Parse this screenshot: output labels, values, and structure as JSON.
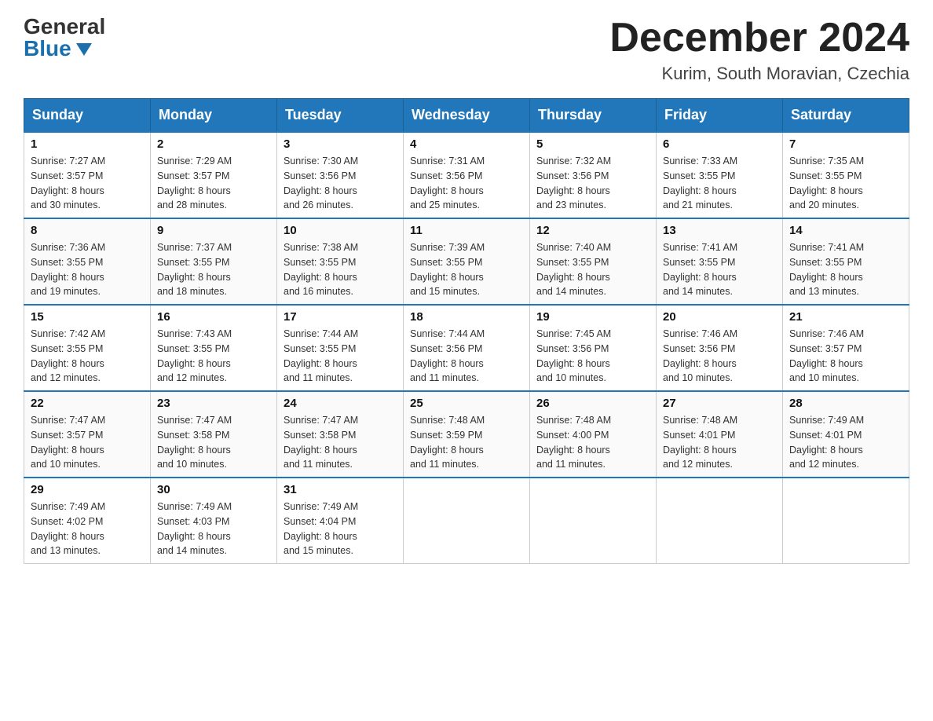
{
  "header": {
    "logo_general": "General",
    "logo_blue": "Blue",
    "month_title": "December 2024",
    "location": "Kurim, South Moravian, Czechia"
  },
  "days_of_week": [
    "Sunday",
    "Monday",
    "Tuesday",
    "Wednesday",
    "Thursday",
    "Friday",
    "Saturday"
  ],
  "weeks": [
    [
      {
        "day": "1",
        "sunrise": "7:27 AM",
        "sunset": "3:57 PM",
        "daylight": "8 hours and 30 minutes."
      },
      {
        "day": "2",
        "sunrise": "7:29 AM",
        "sunset": "3:57 PM",
        "daylight": "8 hours and 28 minutes."
      },
      {
        "day": "3",
        "sunrise": "7:30 AM",
        "sunset": "3:56 PM",
        "daylight": "8 hours and 26 minutes."
      },
      {
        "day": "4",
        "sunrise": "7:31 AM",
        "sunset": "3:56 PM",
        "daylight": "8 hours and 25 minutes."
      },
      {
        "day": "5",
        "sunrise": "7:32 AM",
        "sunset": "3:56 PM",
        "daylight": "8 hours and 23 minutes."
      },
      {
        "day": "6",
        "sunrise": "7:33 AM",
        "sunset": "3:55 PM",
        "daylight": "8 hours and 21 minutes."
      },
      {
        "day": "7",
        "sunrise": "7:35 AM",
        "sunset": "3:55 PM",
        "daylight": "8 hours and 20 minutes."
      }
    ],
    [
      {
        "day": "8",
        "sunrise": "7:36 AM",
        "sunset": "3:55 PM",
        "daylight": "8 hours and 19 minutes."
      },
      {
        "day": "9",
        "sunrise": "7:37 AM",
        "sunset": "3:55 PM",
        "daylight": "8 hours and 18 minutes."
      },
      {
        "day": "10",
        "sunrise": "7:38 AM",
        "sunset": "3:55 PM",
        "daylight": "8 hours and 16 minutes."
      },
      {
        "day": "11",
        "sunrise": "7:39 AM",
        "sunset": "3:55 PM",
        "daylight": "8 hours and 15 minutes."
      },
      {
        "day": "12",
        "sunrise": "7:40 AM",
        "sunset": "3:55 PM",
        "daylight": "8 hours and 14 minutes."
      },
      {
        "day": "13",
        "sunrise": "7:41 AM",
        "sunset": "3:55 PM",
        "daylight": "8 hours and 14 minutes."
      },
      {
        "day": "14",
        "sunrise": "7:41 AM",
        "sunset": "3:55 PM",
        "daylight": "8 hours and 13 minutes."
      }
    ],
    [
      {
        "day": "15",
        "sunrise": "7:42 AM",
        "sunset": "3:55 PM",
        "daylight": "8 hours and 12 minutes."
      },
      {
        "day": "16",
        "sunrise": "7:43 AM",
        "sunset": "3:55 PM",
        "daylight": "8 hours and 12 minutes."
      },
      {
        "day": "17",
        "sunrise": "7:44 AM",
        "sunset": "3:55 PM",
        "daylight": "8 hours and 11 minutes."
      },
      {
        "day": "18",
        "sunrise": "7:44 AM",
        "sunset": "3:56 PM",
        "daylight": "8 hours and 11 minutes."
      },
      {
        "day": "19",
        "sunrise": "7:45 AM",
        "sunset": "3:56 PM",
        "daylight": "8 hours and 10 minutes."
      },
      {
        "day": "20",
        "sunrise": "7:46 AM",
        "sunset": "3:56 PM",
        "daylight": "8 hours and 10 minutes."
      },
      {
        "day": "21",
        "sunrise": "7:46 AM",
        "sunset": "3:57 PM",
        "daylight": "8 hours and 10 minutes."
      }
    ],
    [
      {
        "day": "22",
        "sunrise": "7:47 AM",
        "sunset": "3:57 PM",
        "daylight": "8 hours and 10 minutes."
      },
      {
        "day": "23",
        "sunrise": "7:47 AM",
        "sunset": "3:58 PM",
        "daylight": "8 hours and 10 minutes."
      },
      {
        "day": "24",
        "sunrise": "7:47 AM",
        "sunset": "3:58 PM",
        "daylight": "8 hours and 11 minutes."
      },
      {
        "day": "25",
        "sunrise": "7:48 AM",
        "sunset": "3:59 PM",
        "daylight": "8 hours and 11 minutes."
      },
      {
        "day": "26",
        "sunrise": "7:48 AM",
        "sunset": "4:00 PM",
        "daylight": "8 hours and 11 minutes."
      },
      {
        "day": "27",
        "sunrise": "7:48 AM",
        "sunset": "4:01 PM",
        "daylight": "8 hours and 12 minutes."
      },
      {
        "day": "28",
        "sunrise": "7:49 AM",
        "sunset": "4:01 PM",
        "daylight": "8 hours and 12 minutes."
      }
    ],
    [
      {
        "day": "29",
        "sunrise": "7:49 AM",
        "sunset": "4:02 PM",
        "daylight": "8 hours and 13 minutes."
      },
      {
        "day": "30",
        "sunrise": "7:49 AM",
        "sunset": "4:03 PM",
        "daylight": "8 hours and 14 minutes."
      },
      {
        "day": "31",
        "sunrise": "7:49 AM",
        "sunset": "4:04 PM",
        "daylight": "8 hours and 15 minutes."
      },
      null,
      null,
      null,
      null
    ]
  ],
  "labels": {
    "sunrise": "Sunrise:",
    "sunset": "Sunset:",
    "daylight": "Daylight:"
  }
}
